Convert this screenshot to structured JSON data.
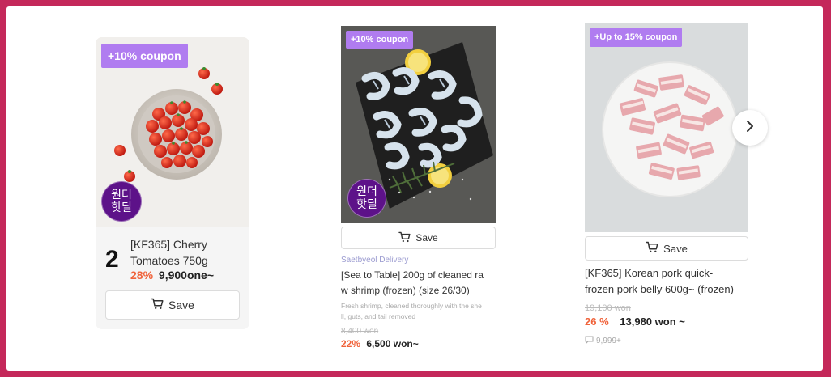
{
  "product1": {
    "coupon": "+10% coupon",
    "badge_line1": "원더",
    "badge_line2": "핫딜",
    "rank": "2",
    "title_line1": "[KF365] Cherry",
    "title_line2": "Tomatoes 750g",
    "discount": "28%",
    "price": "9,900one~",
    "save_label": "Save"
  },
  "product2": {
    "coupon": "+10% coupon",
    "badge_line1": "원더",
    "badge_line2": "핫딜",
    "save_label": "Save",
    "vendor": "Saetbyeol Delivery",
    "title_line1": "[Sea to Table] 200g of cleaned ra",
    "title_line2": "w shrimp (frozen) (size 26/30)",
    "desc_line1": "Fresh shrimp, cleaned thoroughly with the she",
    "desc_line2": "ll, guts, and tail removed",
    "original_price": "8,400 won",
    "discount": "22%",
    "price": "6,500 won~"
  },
  "product3": {
    "coupon": "+Up to 15% coupon",
    "save_label": "Save",
    "title_line1": "[KF365] Korean pork quick-",
    "title_line2": "frozen pork belly 600g~ (frozen)",
    "original_price": "19,100 won",
    "discount": "26 %",
    "price": "13,980 won ~",
    "reviews": "9,999+"
  },
  "colors": {
    "frame": "#c4285a",
    "coupon": "#b07cf0",
    "badge": "#5d1289",
    "discount": "#f0633b"
  },
  "icons": {
    "cart": "cart-icon",
    "next": "chevron-right-icon",
    "comment": "comment-icon"
  }
}
